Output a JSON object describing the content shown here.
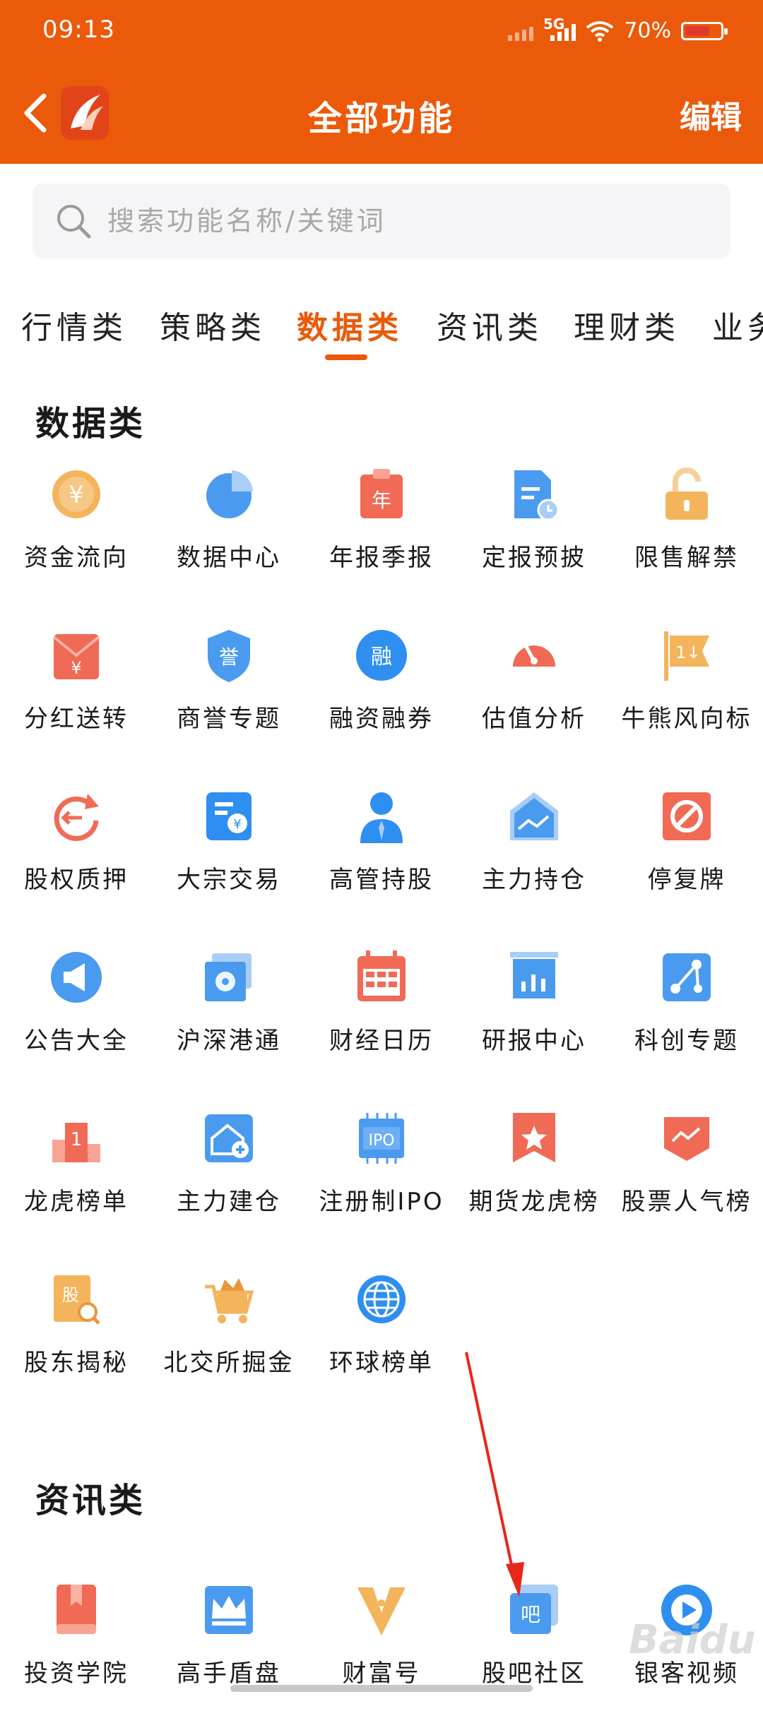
{
  "status_bar": {
    "time": "09:13",
    "network": "5G",
    "battery": "70%",
    "battery_level": 0.7
  },
  "header": {
    "title": "全部功能",
    "edit_label": "编辑"
  },
  "search": {
    "placeholder": "搜索功能名称/关键词"
  },
  "tabs": [
    {
      "label": "行情类"
    },
    {
      "label": "策略类"
    },
    {
      "label": "数据类",
      "active": true
    },
    {
      "label": "资讯类"
    },
    {
      "label": "理财类"
    },
    {
      "label": "业务"
    }
  ],
  "sections": [
    {
      "title": "数据类",
      "items": [
        {
          "label": "资金流向",
          "icon": "coin-yuan-icon",
          "color": "#f3b45c"
        },
        {
          "label": "数据中心",
          "icon": "pie-chart-icon",
          "color": "#4a9bf0"
        },
        {
          "label": "年报季报",
          "icon": "annual-report-icon",
          "color": "#f06a55",
          "glyph": "年"
        },
        {
          "label": "定报预披",
          "icon": "document-clock-icon",
          "color": "#4a9bf0"
        },
        {
          "label": "限售解禁",
          "icon": "unlock-icon",
          "color": "#f3b45c"
        },
        {
          "label": "分红送转",
          "icon": "red-envelope-icon",
          "color": "#f06a55"
        },
        {
          "label": "商誉专题",
          "icon": "shield-badge-icon",
          "color": "#4a9bf0",
          "glyph": "誉"
        },
        {
          "label": "融资融券",
          "icon": "margin-circle-icon",
          "color": "#2e8ff0",
          "glyph": "融"
        },
        {
          "label": "估值分析",
          "icon": "gauge-icon",
          "color": "#f06a55"
        },
        {
          "label": "牛熊风向标",
          "icon": "flag-icon",
          "color": "#f3b45c"
        },
        {
          "label": "股权质押",
          "icon": "rotate-arrow-icon",
          "color": "#f06a55"
        },
        {
          "label": "大宗交易",
          "icon": "trade-doc-icon",
          "color": "#2e8ff0"
        },
        {
          "label": "高管持股",
          "icon": "executive-person-icon",
          "color": "#2e8ff0"
        },
        {
          "label": "主力持仓",
          "icon": "house-chart-icon",
          "color": "#4a9bf0"
        },
        {
          "label": "停复牌",
          "icon": "stop-sign-icon",
          "color": "#f06a55"
        },
        {
          "label": "公告大全",
          "icon": "megaphone-icon",
          "color": "#4a9bf0"
        },
        {
          "label": "沪深港通",
          "icon": "hk-flower-icon",
          "color": "#4a9bf0"
        },
        {
          "label": "财经日历",
          "icon": "calendar-icon",
          "color": "#f06a55"
        },
        {
          "label": "研报中心",
          "icon": "bar-board-icon",
          "color": "#4a9bf0"
        },
        {
          "label": "科创专题",
          "icon": "nodes-icon",
          "color": "#4a9bf0"
        },
        {
          "label": "龙虎榜单",
          "icon": "podium-icon",
          "color": "#f06a55",
          "glyph": "1"
        },
        {
          "label": "主力建仓",
          "icon": "house-plus-icon",
          "color": "#4a9bf0"
        },
        {
          "label": "注册制IPO",
          "icon": "ipo-chip-icon",
          "color": "#4a9bf0",
          "glyph": "IPO"
        },
        {
          "label": "期货龙虎榜",
          "icon": "star-banner-icon",
          "color": "#f06a55"
        },
        {
          "label": "股票人气榜",
          "icon": "trend-banner-icon",
          "color": "#f06a55"
        },
        {
          "label": "股东揭秘",
          "icon": "stock-search-icon",
          "color": "#f3b45c",
          "glyph": "股"
        },
        {
          "label": "北交所掘金",
          "icon": "gold-cart-icon",
          "color": "#f3b45c"
        },
        {
          "label": "环球榜单",
          "icon": "globe-icon",
          "color": "#2e8ff0"
        }
      ]
    },
    {
      "title": "资讯类",
      "items": [
        {
          "label": "投资学院",
          "icon": "book-icon",
          "color": "#f06a55"
        },
        {
          "label": "高手盾盘",
          "icon": "crown-icon",
          "color": "#4a9bf0"
        },
        {
          "label": "财富号",
          "icon": "pen-nib-icon",
          "color": "#f3b45c"
        },
        {
          "label": "股吧社区",
          "icon": "forum-icon",
          "color": "#4a9bf0",
          "glyph": "吧"
        },
        {
          "label": "银客视频",
          "icon": "video-play-icon",
          "color": "#2e8ff0"
        }
      ]
    }
  ],
  "watermark": "Baidu"
}
